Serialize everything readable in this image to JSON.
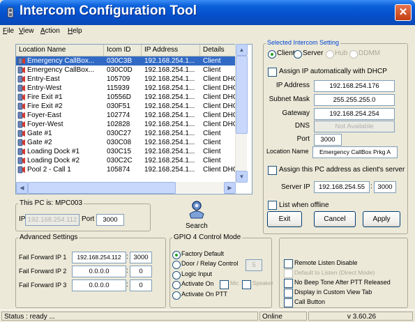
{
  "window": {
    "title": "Intercom Configuration Tool",
    "close_label": "✕"
  },
  "menu": [
    {
      "label": "File",
      "accel": "F",
      "rest": "ile"
    },
    {
      "label": "View",
      "accel": "V",
      "rest": "iew"
    },
    {
      "label": "Action",
      "accel": "A",
      "rest": "ction"
    },
    {
      "label": "Help",
      "accel": "H",
      "rest": "elp"
    }
  ],
  "list": {
    "columns": [
      "Location Name",
      "Icom ID",
      "IP Address",
      "Details"
    ],
    "rows": [
      {
        "name": "Emergency CallBox...",
        "id": "030C3B",
        "ip": "192.168.254.1...",
        "details": "Client",
        "selected": true
      },
      {
        "name": "Emergency CallBox...",
        "id": "030C0D",
        "ip": "192.168.254.1...",
        "details": "Client"
      },
      {
        "name": "Entry-East",
        "id": "105709",
        "ip": "192.168.254.1...",
        "details": "Client DHCP"
      },
      {
        "name": "Entry-West",
        "id": "115939",
        "ip": "192.168.254.1...",
        "details": "Client DHCP"
      },
      {
        "name": "Fire Exit #1",
        "id": "10556D",
        "ip": "192.168.254.1...",
        "details": "Client DHCP"
      },
      {
        "name": "Fire Exit #2",
        "id": "030F51",
        "ip": "192.168.254.1...",
        "details": "Client DHCP"
      },
      {
        "name": "Foyer-East",
        "id": "102774",
        "ip": "192.168.254.1...",
        "details": "Client DHCP"
      },
      {
        "name": "Foyer-West",
        "id": "102828",
        "ip": "192.168.254.1...",
        "details": "Client DHCP"
      },
      {
        "name": "Gate #1",
        "id": "030C27",
        "ip": "192.168.254.1...",
        "details": "Client"
      },
      {
        "name": "Gate #2",
        "id": "030C08",
        "ip": "192.168.254.1...",
        "details": "Client"
      },
      {
        "name": "Loading Dock #1",
        "id": "030C15",
        "ip": "192.168.254.1...",
        "details": "Client"
      },
      {
        "name": "Loading Dock #2",
        "id": "030C2C",
        "ip": "192.168.254.1...",
        "details": "Client"
      },
      {
        "name": "Pool 2 - Call 1",
        "id": "105874",
        "ip": "192.168.254.1...",
        "details": "Client DHCP"
      }
    ]
  },
  "selected_setting": {
    "group_label": "Selected Intercom Setting",
    "modes": [
      {
        "label": "Client",
        "checked": true,
        "enabled": true
      },
      {
        "label": "Server",
        "checked": false,
        "enabled": true
      },
      {
        "label": "Hub",
        "checked": false,
        "enabled": false
      },
      {
        "label": "DDMM",
        "checked": false,
        "enabled": false
      }
    ],
    "dhcp_label": "Assign IP automatically with DHCP",
    "ip_label": "IP Address",
    "ip_value": "192.168.254.176",
    "mask_label": "Subnet Mask",
    "mask_value": "255.255.255.0",
    "gateway_label": "Gateway",
    "gateway_value": "192.168.254.254",
    "dns_label": "DNS",
    "dns_value": "Not Available",
    "port_label": "Port",
    "port_value": "3000",
    "location_label": "Location Name",
    "location_value": "Emergency CallBox Prkg A",
    "assign_server_label": "Assign this PC address as client's server",
    "server_ip_label": "Server IP",
    "server_ip_value": "192.168.254.55",
    "server_port_value": "3000",
    "list_offline_label": "List when offline",
    "exit_label": "Exit",
    "cancel_label": "Cancel",
    "apply_label": "Apply"
  },
  "this_pc": {
    "group_label": "This PC is: MPC003",
    "ip_label": "IP",
    "ip_value": "192.168.254.112",
    "port_label": "Port",
    "port_value": "3000"
  },
  "search_label": "Search",
  "advanced": {
    "group_label": "Advanced Settings",
    "rows": [
      {
        "label": "Fail Forward IP 1",
        "ip": "192.168.254.112",
        "port": "3000"
      },
      {
        "label": "Fail Forward IP 2",
        "ip": "0.0.0.0",
        "port": "0"
      },
      {
        "label": "Fail Forward IP 3",
        "ip": "0.0.0.0",
        "port": "0"
      }
    ]
  },
  "gpio": {
    "group_label": "GPIO 4 Control Mode",
    "factory_default": "Factory Default",
    "door_relay": "Door / Relay Control",
    "door_relay_value": "5",
    "logic_input": "Logic Input",
    "activate_on": "Activate On",
    "mic": "Mic",
    "speaker": "Speaker",
    "activate_on_ptt": "Activate On PTT"
  },
  "options": {
    "remote_listen_disable": "Remote Listen Disable",
    "default_listen": "Default to Listen (Direct Mode)",
    "no_beep": "No Beep Tone After PTT Released",
    "display_custom": "Display in Custom View Tab",
    "call_button": "Call Button"
  },
  "status": {
    "text": "Status : ready ...",
    "online": "Online",
    "version": "v 3.60.26"
  }
}
